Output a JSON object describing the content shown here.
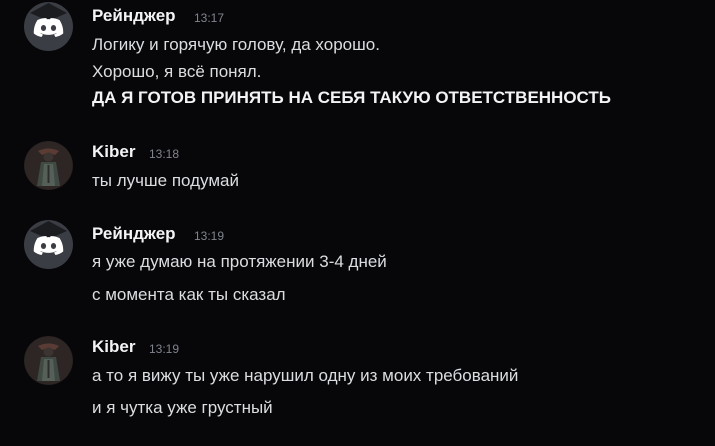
{
  "colors": {
    "background": "#070709",
    "username": "#f2f3f5",
    "message_text": "#dbdee1",
    "timestamp": "#80848e",
    "discord_blurple": "#5865f2"
  },
  "messages": [
    {
      "author": "Рейнджер",
      "time": "13:17",
      "avatar_icon": "discord-logo-icon",
      "lines": [
        "Логику и горячую голову, да хорошо.",
        "Хорошо, я всё понял.",
        "ДА Я ГОТОВ ПРИНЯТЬ НА СЕБЯ ТАКУЮ ОТВЕТСТВЕННОСТЬ"
      ]
    },
    {
      "author": "Kiber",
      "time": "13:18",
      "avatar_icon": "dark-figure-avatar",
      "lines": [
        "ты лучше подумай"
      ]
    },
    {
      "author": "Рейнджер",
      "time": "13:19",
      "avatar_icon": "discord-logo-icon",
      "lines": [
        "я уже думаю на протяжении 3-4 дней",
        "с момента как ты сказал"
      ]
    },
    {
      "author": "Kiber",
      "time": "13:19",
      "avatar_icon": "dark-figure-avatar",
      "lines": [
        "а то я вижу ты уже нарушил одну из моих требований",
        "и я чутка уже грустный"
      ]
    }
  ]
}
